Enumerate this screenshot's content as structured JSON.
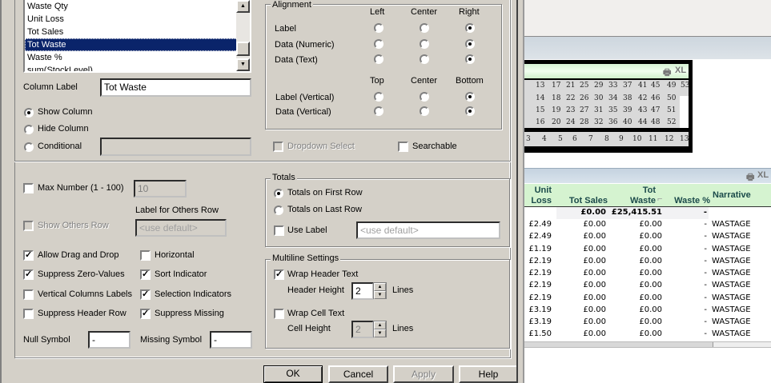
{
  "fields": {
    "items": [
      "Waste Qty",
      "Unit Loss",
      "Tot Sales",
      "Tot Waste",
      "Waste %",
      "sum(StockLevel)"
    ],
    "selected": "Tot Waste"
  },
  "column_label": {
    "label": "Column Label",
    "value": "Tot Waste"
  },
  "visibility": {
    "show": "Show Column",
    "hide": "Hide Column",
    "conditional": "Conditional",
    "selected": "show"
  },
  "alignment": {
    "caption": "Alignment",
    "h_headers": [
      "Left",
      "Center",
      "Right"
    ],
    "h_rows": [
      {
        "label": "Label",
        "selected": "Right"
      },
      {
        "label": "Data (Numeric)",
        "selected": "Right"
      },
      {
        "label": "Data (Text)",
        "selected": "Right"
      }
    ],
    "v_headers": [
      "Top",
      "Center",
      "Bottom"
    ],
    "v_rows": [
      {
        "label": "Label (Vertical)",
        "selected": "Bottom"
      },
      {
        "label": "Data (Vertical)",
        "selected": "Bottom"
      }
    ]
  },
  "dropdown_select": {
    "label": "Dropdown Select",
    "checked": false,
    "disabled": true
  },
  "searchable": {
    "label": "Searchable",
    "checked": false
  },
  "max_number": {
    "label": "Max Number (1 - 100)",
    "checked": false,
    "value": "10"
  },
  "others": {
    "show_label": "Show Others Row",
    "label_caption": "Label for Others Row",
    "placeholder": "<use default>"
  },
  "options": [
    {
      "label": "Allow Drag and Drop",
      "checked": true
    },
    {
      "label": "Horizontal",
      "checked": false
    },
    {
      "label": "Suppress Zero-Values",
      "checked": true
    },
    {
      "label": "Sort Indicator",
      "checked": true
    },
    {
      "label": "Vertical Columns Labels",
      "checked": false
    },
    {
      "label": "Selection Indicators",
      "checked": true
    },
    {
      "label": "Suppress Header Row",
      "checked": false
    },
    {
      "label": "Suppress Missing",
      "checked": true
    }
  ],
  "null_symbol": {
    "label": "Null Symbol",
    "value": "-"
  },
  "missing_symbol": {
    "label": "Missing Symbol",
    "value": "-"
  },
  "totals": {
    "caption": "Totals",
    "first": "Totals on First Row",
    "last": "Totals on Last Row",
    "use_label": "Use Label",
    "placeholder": "<use default>"
  },
  "multiline": {
    "caption": "Multiline Settings",
    "wrap_header": "Wrap Header Text",
    "header_height_label": "Header Height",
    "header_height": "2",
    "lines": "Lines",
    "wrap_cell": "Wrap Cell Text",
    "cell_height_label": "Cell Height",
    "cell_height": "2"
  },
  "buttons": {
    "ok": "OK",
    "cancel": "Cancel",
    "apply": "Apply",
    "help": "Help"
  },
  "app": {
    "xl": "XL",
    "calendar_rows": [
      [
        "13",
        "17",
        "21",
        "25",
        "29",
        "33",
        "37",
        "41",
        "45",
        "49",
        "53"
      ],
      [
        "14",
        "18",
        "22",
        "26",
        "30",
        "34",
        "38",
        "42",
        "46",
        "50"
      ],
      [
        "15",
        "19",
        "23",
        "27",
        "31",
        "35",
        "39",
        "43",
        "47",
        "51"
      ],
      [
        "16",
        "20",
        "24",
        "28",
        "32",
        "36",
        "40",
        "44",
        "48",
        "52"
      ]
    ],
    "month_row": [
      "3",
      "4",
      "5",
      "6",
      "7",
      "8",
      "9",
      "10",
      "11",
      "12",
      "13"
    ],
    "table": {
      "headers": [
        [
          "Unit",
          "Loss"
        ],
        [
          "",
          "Tot Sales"
        ],
        [
          "Tot",
          "Waste"
        ],
        [
          "",
          "Waste %"
        ],
        [
          "",
          "Narrative"
        ]
      ],
      "totals": [
        "",
        "£0.00",
        "£25,415.51",
        "-",
        ""
      ],
      "rows": [
        [
          "£2.49",
          "£0.00",
          "£0.00",
          "-",
          "WASTAGE"
        ],
        [
          "£2.49",
          "£0.00",
          "£0.00",
          "-",
          "WASTAGE"
        ],
        [
          "£1.19",
          "£0.00",
          "£0.00",
          "-",
          "WASTAGE"
        ],
        [
          "£2.19",
          "£0.00",
          "£0.00",
          "-",
          "WASTAGE"
        ],
        [
          "£2.19",
          "£0.00",
          "£0.00",
          "-",
          "WASTAGE"
        ],
        [
          "£2.19",
          "£0.00",
          "£0.00",
          "-",
          "WASTAGE"
        ],
        [
          "£2.19",
          "£0.00",
          "£0.00",
          "-",
          "WASTAGE"
        ],
        [
          "£3.19",
          "£0.00",
          "£0.00",
          "-",
          "WASTAGE"
        ],
        [
          "£3.19",
          "£0.00",
          "£0.00",
          "-",
          "WASTAGE"
        ],
        [
          "£1.50",
          "£0.00",
          "£0.00",
          "-",
          "WASTAGE"
        ]
      ]
    }
  }
}
